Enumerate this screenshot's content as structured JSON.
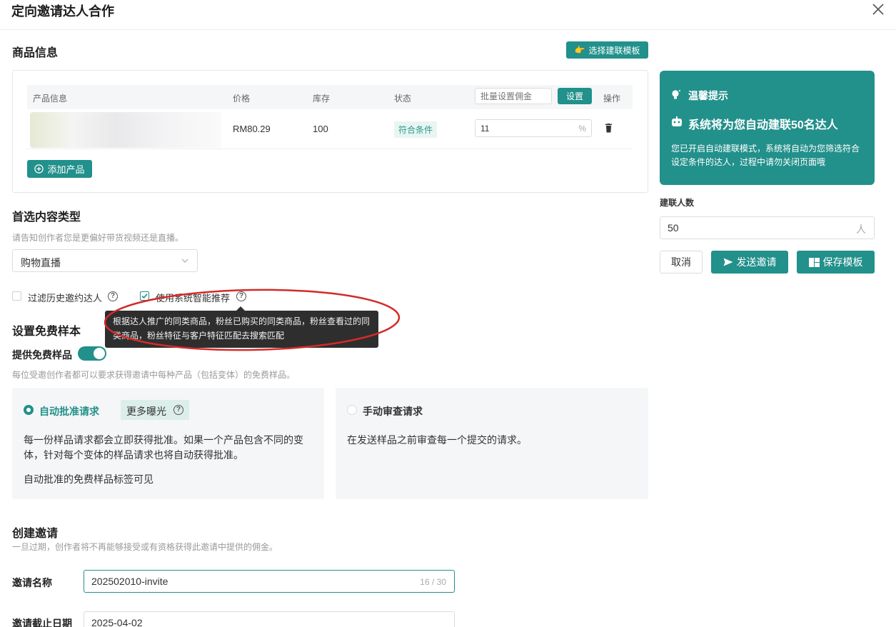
{
  "header": {
    "title": "定向邀请达人合作"
  },
  "product_section": {
    "title": "商品信息",
    "template_button": "选择建联模板",
    "table": {
      "columns": [
        "产品信息",
        "价格",
        "库存",
        "状态",
        "操作"
      ],
      "bulk_placeholder": "批量设置佣金",
      "set_button": "设置",
      "rows": [
        {
          "price": "RM80.29",
          "stock": "100",
          "status": "符合条件",
          "commission": "11",
          "unit": "%"
        }
      ]
    },
    "add_button": "添加产品"
  },
  "content_type": {
    "title": "首选内容类型",
    "hint": "请告知创作者您是更偏好带货视频还是直播。",
    "selected": "购物直播"
  },
  "options": {
    "filter_history": "过滤历史邀约达人",
    "smart_recommend": "使用系统智能推荐"
  },
  "tooltip": {
    "text": "根据达人推广的同类商品，粉丝已购买的同类商品，粉丝查看过的同类商品，粉丝特征与客户特征匹配去搜索匹配"
  },
  "free_sample": {
    "title": "设置免费样本",
    "toggle_label": "提供免费样品",
    "toggle_on": true,
    "hint": "每位受邀创作者都可以要求获得邀请中每种产品（包括变体）的免费样品。",
    "auto": {
      "title": "自动批准请求",
      "badge": "更多曝光",
      "desc": "每一份样品请求都会立即获得批准。如果一个产品包含不同的变体，针对每个变体的样品请求也将自动获得批准。",
      "note": "自动批准的免费样品标签可见"
    },
    "manual": {
      "title": "手动审查请求",
      "desc": "在发送样品之前审查每一个提交的请求。"
    }
  },
  "create_invite": {
    "title": "创建邀请",
    "hint": "一旦过期，创作者将不再能够接受或有资格获得此邀请中提供的佣金。",
    "name_label": "邀请名称",
    "name_value": "202502010-invite",
    "name_count": "16 / 30",
    "date_label": "邀请截止日期",
    "date_value": "2025-04-02"
  },
  "tip_panel": {
    "title": "温馨提示",
    "headline": "系统将为您自动建联50名达人",
    "desc": "您已开启自动建联模式，系统将自动为您筛选符合设定条件的达人，过程中请勿关闭页面哦"
  },
  "contact_count": {
    "label": "建联人数",
    "value": "50",
    "unit": "人"
  },
  "actions": {
    "cancel": "取消",
    "send": "发送邀请",
    "save": "保存模板"
  },
  "colors": {
    "accent": "#22908b",
    "annotation": "#d42a2a"
  }
}
